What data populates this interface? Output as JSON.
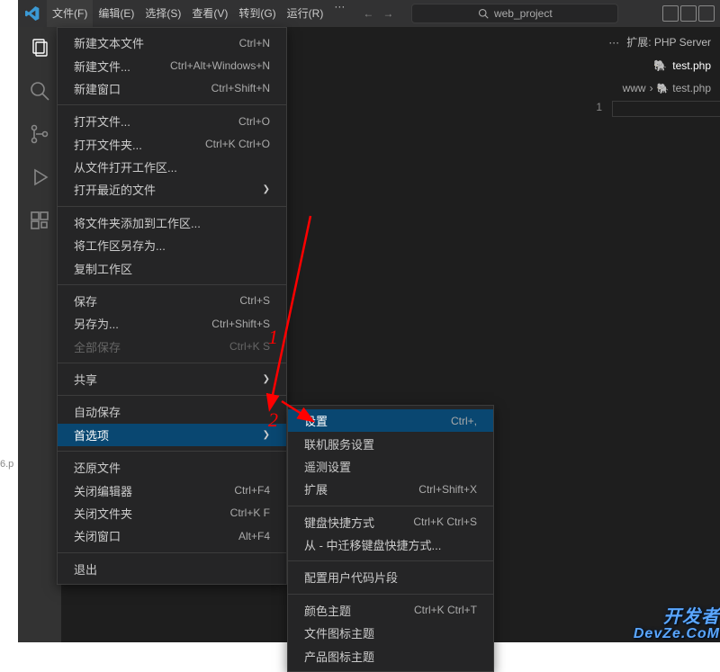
{
  "titlebar": {
    "menu": [
      "文件(F)",
      "编辑(E)",
      "选择(S)",
      "查看(V)",
      "转到(G)",
      "运行(R)"
    ],
    "more": "···",
    "search_text": "web_project"
  },
  "ext_bar": {
    "dots": "···",
    "label": "扩展: PHP Server"
  },
  "tab": {
    "label": "test.php"
  },
  "breadcrumb": {
    "seg1": "www",
    "seg2": "test.php"
  },
  "gutter": {
    "line1": "1"
  },
  "file_menu": {
    "groups": [
      [
        {
          "label": "新建文本文件",
          "shortcut": "Ctrl+N"
        },
        {
          "label": "新建文件...",
          "shortcut": "Ctrl+Alt+Windows+N"
        },
        {
          "label": "新建窗口",
          "shortcut": "Ctrl+Shift+N"
        }
      ],
      [
        {
          "label": "打开文件...",
          "shortcut": "Ctrl+O"
        },
        {
          "label": "打开文件夹...",
          "shortcut": "Ctrl+K Ctrl+O"
        },
        {
          "label": "从文件打开工作区...",
          "shortcut": ""
        },
        {
          "label": "打开最近的文件",
          "shortcut": "",
          "submenu": true
        }
      ],
      [
        {
          "label": "将文件夹添加到工作区...",
          "shortcut": ""
        },
        {
          "label": "将工作区另存为...",
          "shortcut": ""
        },
        {
          "label": "复制工作区",
          "shortcut": ""
        }
      ],
      [
        {
          "label": "保存",
          "shortcut": "Ctrl+S"
        },
        {
          "label": "另存为...",
          "shortcut": "Ctrl+Shift+S"
        },
        {
          "label": "全部保存",
          "shortcut": "Ctrl+K S",
          "disabled": true
        }
      ],
      [
        {
          "label": "共享",
          "shortcut": "",
          "submenu": true
        }
      ],
      [
        {
          "label": "自动保存",
          "shortcut": ""
        },
        {
          "label": "首选项",
          "shortcut": "",
          "submenu": true,
          "highlight": true
        }
      ],
      [
        {
          "label": "还原文件",
          "shortcut": ""
        },
        {
          "label": "关闭编辑器",
          "shortcut": "Ctrl+F4"
        },
        {
          "label": "关闭文件夹",
          "shortcut": "Ctrl+K F"
        },
        {
          "label": "关闭窗口",
          "shortcut": "Alt+F4"
        }
      ],
      [
        {
          "label": "退出",
          "shortcut": ""
        }
      ]
    ]
  },
  "pref_submenu": {
    "groups": [
      [
        {
          "label": "设置",
          "shortcut": "Ctrl+,",
          "highlight": true
        },
        {
          "label": "联机服务设置",
          "shortcut": ""
        },
        {
          "label": "遥测设置",
          "shortcut": ""
        },
        {
          "label": "扩展",
          "shortcut": "Ctrl+Shift+X"
        }
      ],
      [
        {
          "label": "键盘快捷方式",
          "shortcut": "Ctrl+K Ctrl+S"
        },
        {
          "label": "从 - 中迁移键盘快捷方式...",
          "shortcut": ""
        }
      ],
      [
        {
          "label": "配置用户代码片段",
          "shortcut": ""
        }
      ],
      [
        {
          "label": "颜色主题",
          "shortcut": "Ctrl+K Ctrl+T"
        },
        {
          "label": "文件图标主题",
          "shortcut": ""
        },
        {
          "label": "产品图标主题",
          "shortcut": ""
        }
      ]
    ]
  },
  "annotations": {
    "a1": "1",
    "a2": "2"
  },
  "left_edge": "6.p",
  "watermark": {
    "l1": "开发者",
    "l2": "DevZe.CoM"
  }
}
